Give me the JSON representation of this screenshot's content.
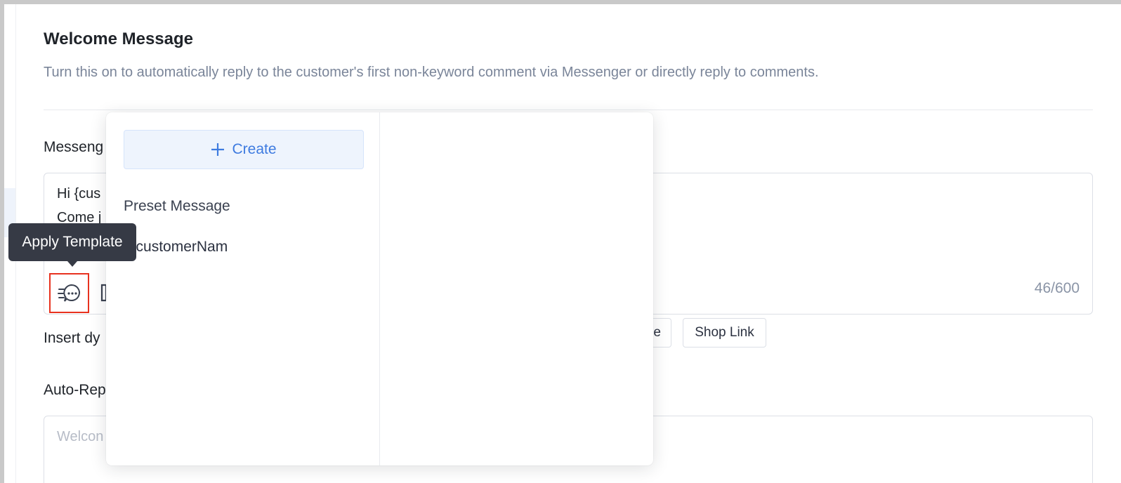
{
  "welcome": {
    "title": "Welcome Message",
    "description": "Turn this on to automatically reply to the customer's first non-keyword comment via Messenger or directly reply to comments."
  },
  "messenger": {
    "label": "Messeng",
    "line1": "Hi {cus",
    "line2": "Come j",
    "counter": "46/600"
  },
  "insert": {
    "label": "Insert dy",
    "chips": [
      {
        "label": "e"
      },
      {
        "label": "Shop Link"
      }
    ]
  },
  "auto_reply": {
    "label": "Auto-Rep",
    "placeholder": "Welcon"
  },
  "template_popover": {
    "create_label": "Create",
    "group_label": "Preset Message",
    "items": [
      {
        "label": "i {customerNam"
      }
    ]
  },
  "tooltip": {
    "label": "Apply Template"
  },
  "icons": {
    "apply_template": "chat-template-icon",
    "create": "plus-icon",
    "second_tool": "bracket-icon"
  },
  "colors": {
    "accent": "#3e7be0",
    "highlight_border": "#e8321f",
    "tooltip_bg": "#363a45"
  }
}
